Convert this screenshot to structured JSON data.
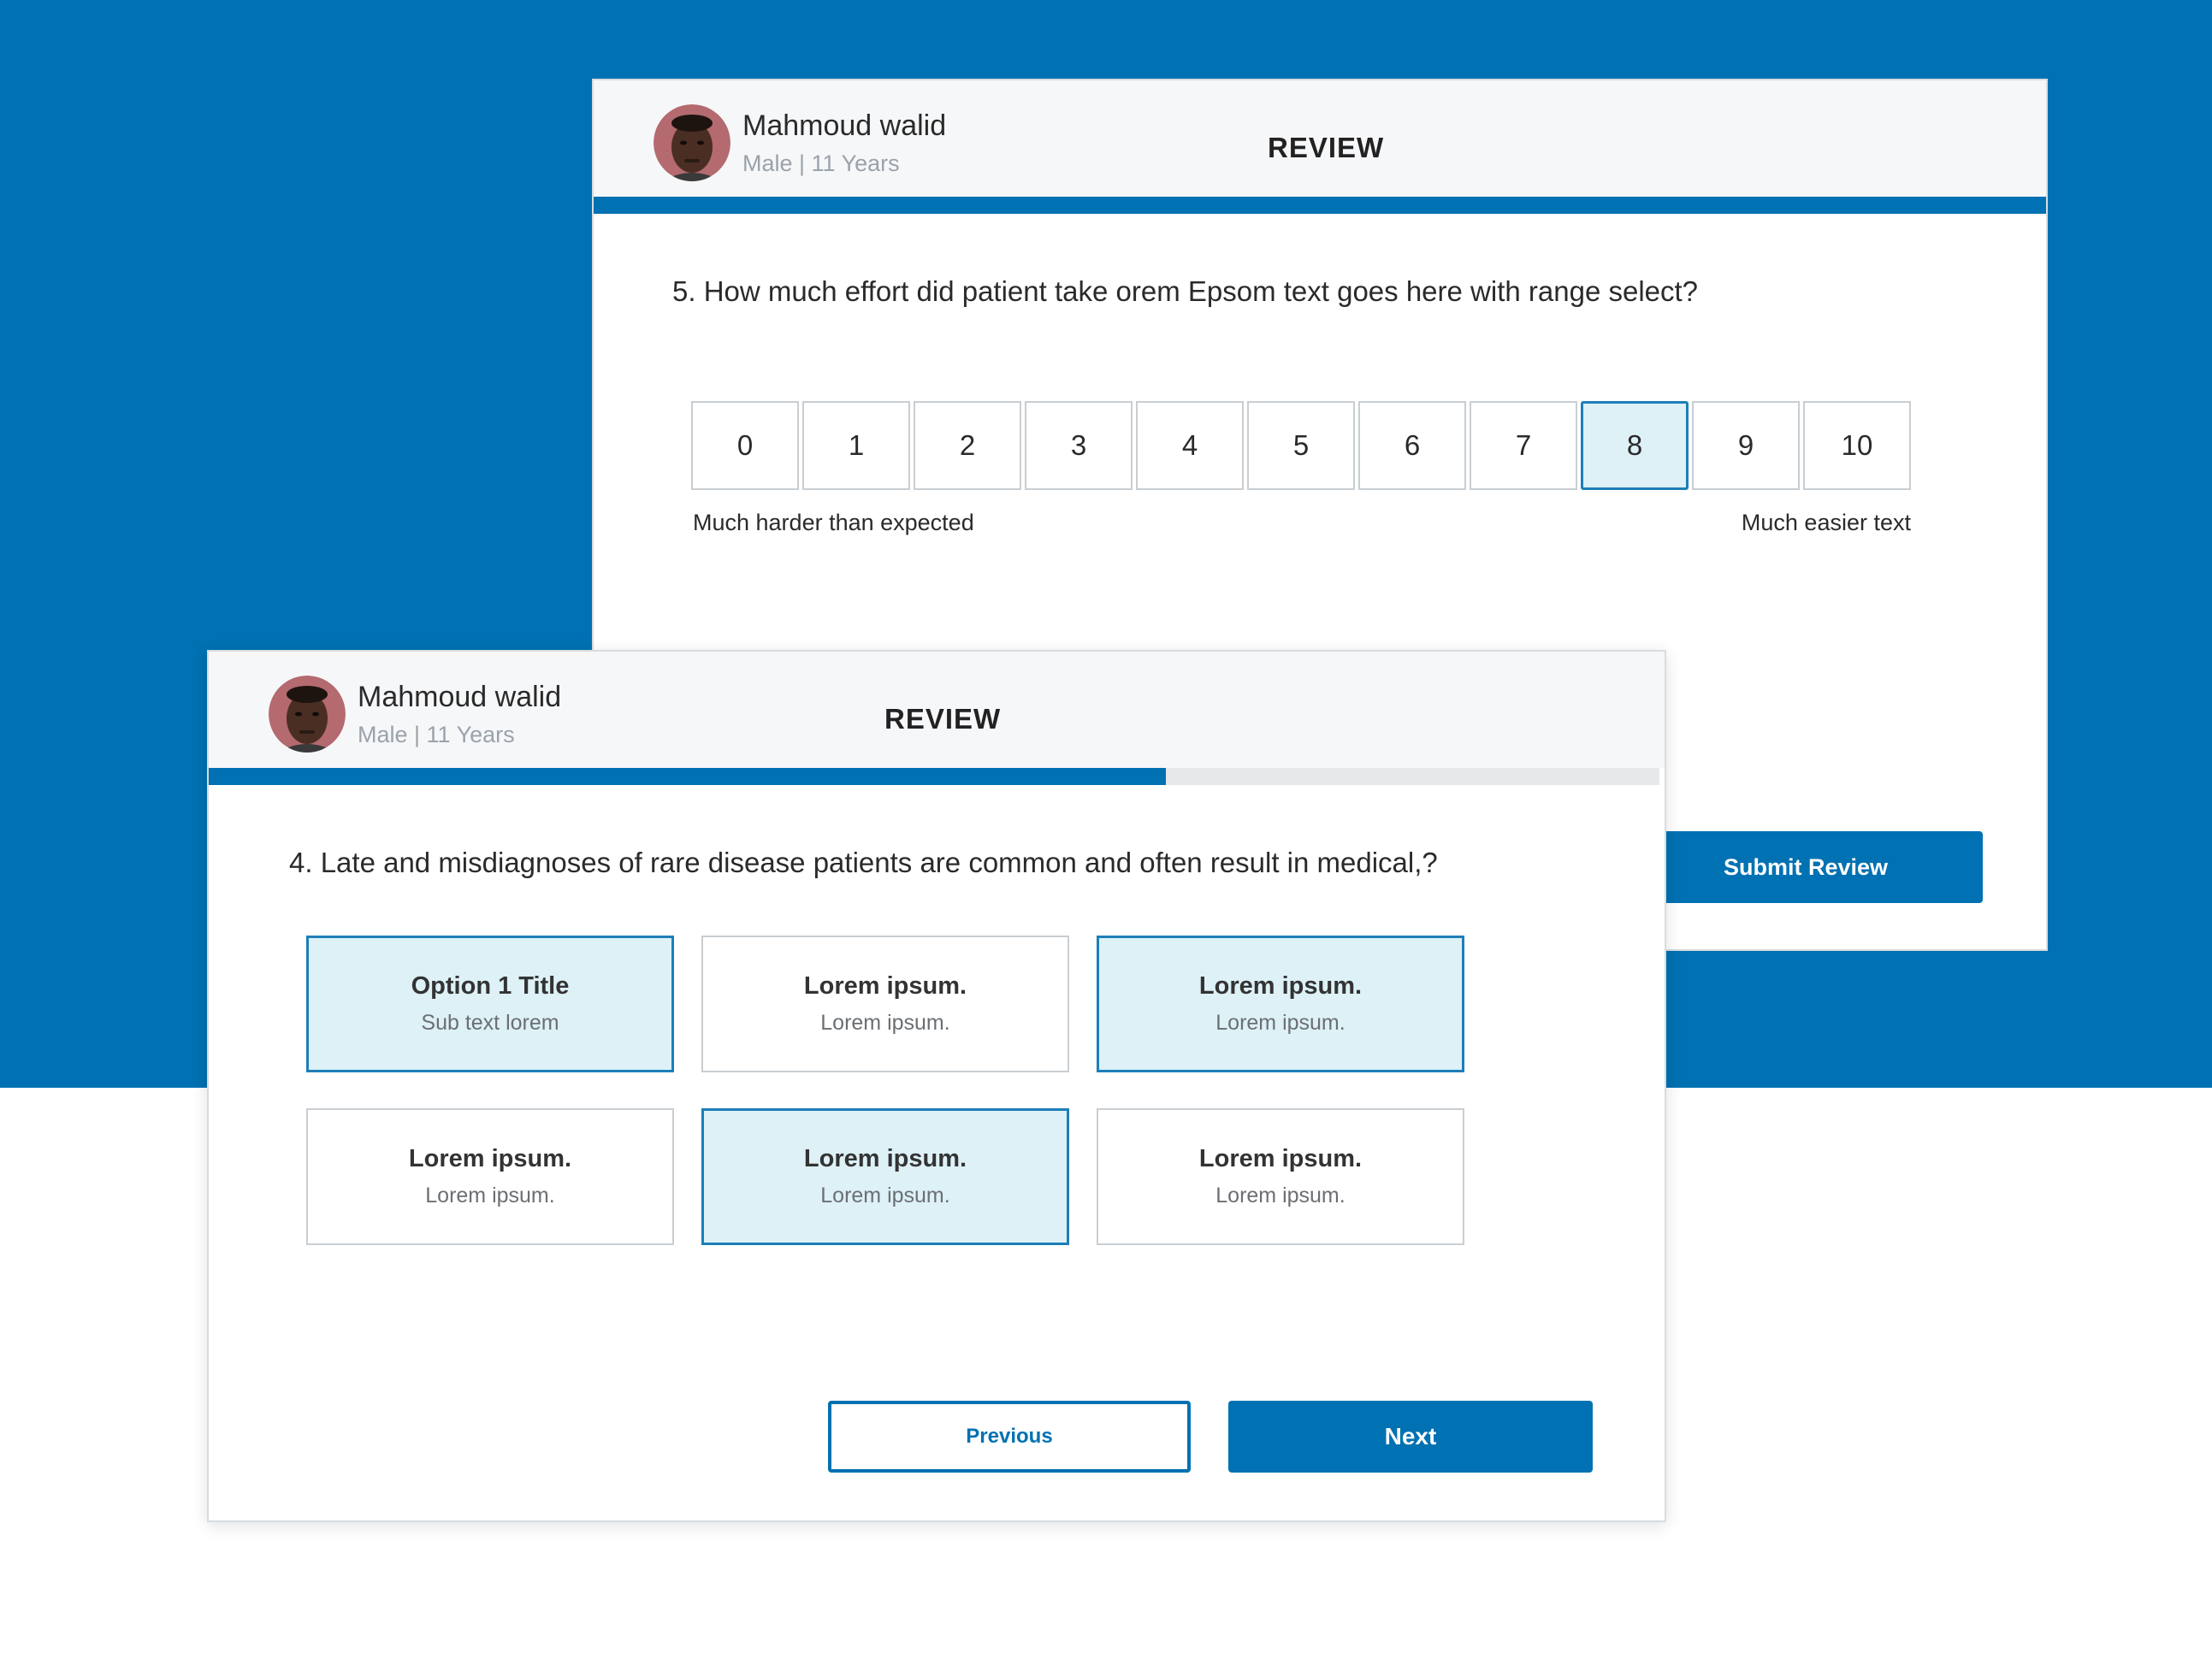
{
  "colors": {
    "brand": "#0071b2",
    "selected_bg": "#ddf1f7",
    "selected_border": "#1c7fb8"
  },
  "back_card": {
    "patient": {
      "name": "Mahmoud walid",
      "info": "Male | 11 Years",
      "avatar_icon": "avatar-photo"
    },
    "title": "REVIEW",
    "progress": 1.0,
    "question": "5. How much effort did patient take orem Epsom text goes here with range select?",
    "scale": {
      "values": [
        "0",
        "1",
        "2",
        "3",
        "4",
        "5",
        "6",
        "7",
        "8",
        "9",
        "10"
      ],
      "selected": "8",
      "min_label": "Much harder than expected",
      "max_label": "Much easier text"
    },
    "submit_label": "Submit Review"
  },
  "front_card": {
    "patient": {
      "name": "Mahmoud walid",
      "info": "Male | 11 Years",
      "avatar_icon": "avatar-photo"
    },
    "title": "REVIEW",
    "progress": 0.66,
    "question": "4. Late and misdiagnoses of rare disease patients are common and often result in medical,?",
    "options": [
      {
        "title": "Option 1 Title",
        "sub": "Sub text lorem",
        "selected": true
      },
      {
        "title": "Lorem ipsum.",
        "sub": "Lorem ipsum.",
        "selected": false
      },
      {
        "title": "Lorem ipsum.",
        "sub": "Lorem ipsum.",
        "selected": true
      },
      {
        "title": "Lorem ipsum.",
        "sub": "Lorem ipsum.",
        "selected": false
      },
      {
        "title": "Lorem ipsum.",
        "sub": "Lorem ipsum.",
        "selected": true
      },
      {
        "title": "Lorem ipsum.",
        "sub": "Lorem ipsum.",
        "selected": false
      }
    ],
    "previous_label": "Previous",
    "next_label": "Next"
  }
}
